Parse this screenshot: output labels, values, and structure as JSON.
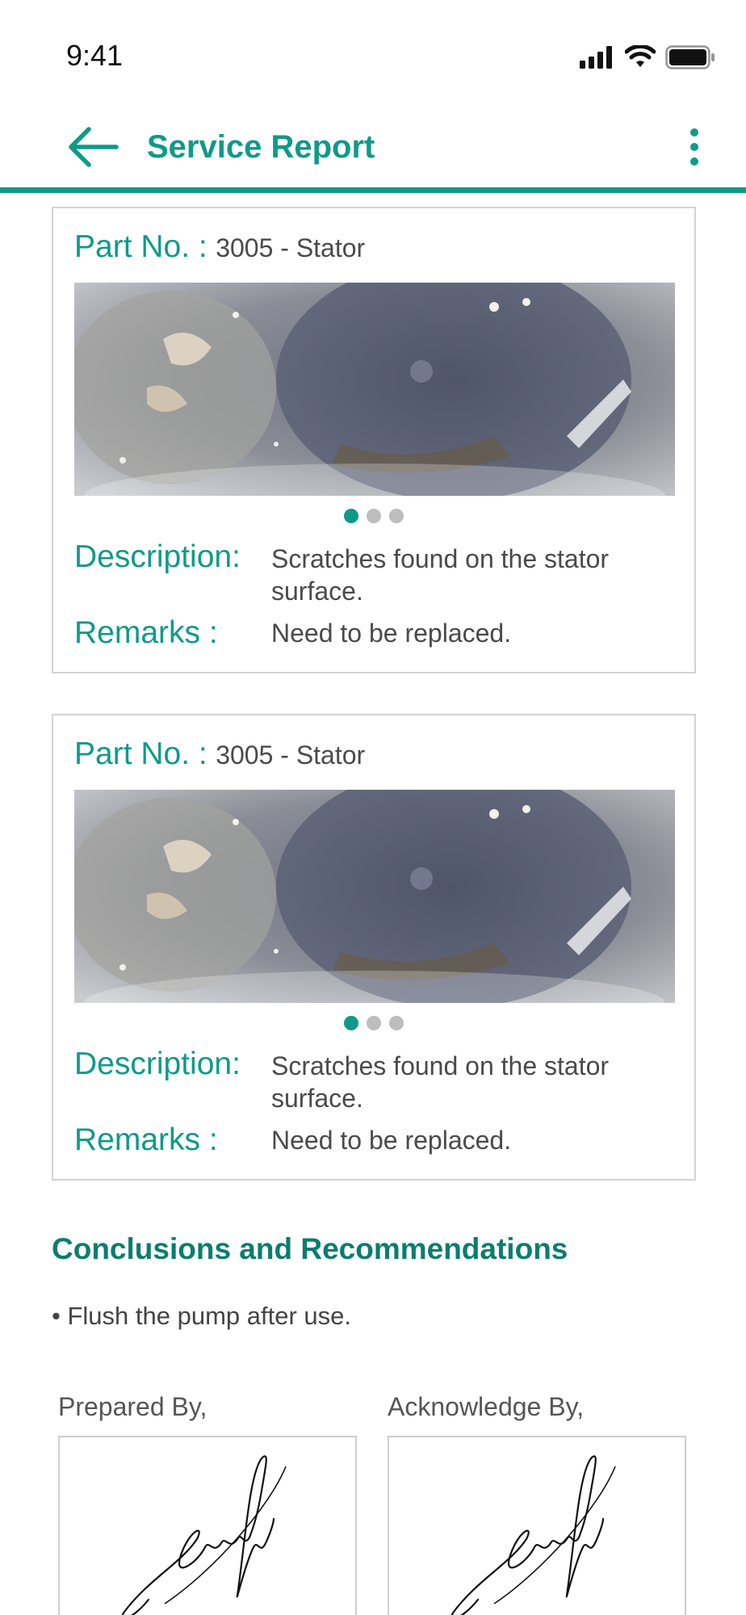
{
  "status_bar": {
    "time": "9:41"
  },
  "app_bar": {
    "title": "Service Report"
  },
  "cards": [
    {
      "part_label": "Part No. :",
      "part_value": "3005 - Stator",
      "carousel": {
        "total": 3,
        "active_index": 0
      },
      "description_label": "Description:",
      "description_value": "Scratches found on the stator surface.",
      "remarks_label": "Remarks :",
      "remarks_value": "Need to be replaced."
    },
    {
      "part_label": "Part No. :",
      "part_value": "3005 - Stator",
      "carousel": {
        "total": 3,
        "active_index": 0
      },
      "description_label": "Description:",
      "description_value": "Scratches found on the stator surface.",
      "remarks_label": "Remarks :",
      "remarks_value": "Need to be replaced."
    }
  ],
  "conclusions": {
    "title": "Conclusions and Recommendations",
    "items": [
      "• Flush the pump after use."
    ]
  },
  "signatures": {
    "prepared_label": "Prepared By,",
    "acknowledge_label": "Acknowledge By,"
  },
  "colors": {
    "accent": "#0f9a88",
    "accent_dark": "#0b7d6e",
    "border": "#d3d3d3"
  },
  "icons": {
    "back": "arrow-left-icon",
    "more": "more-vertical-icon",
    "signal": "cellular-signal-icon",
    "wifi": "wifi-icon",
    "battery": "battery-icon"
  }
}
